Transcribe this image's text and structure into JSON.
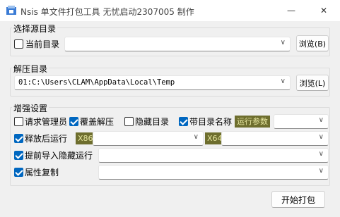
{
  "window": {
    "title": "Nsis 单文件打包工具 无忧启动2307005 制作",
    "minimize_glyph": "—",
    "close_glyph": "✕",
    "app_icon": "nsis-installer-icon"
  },
  "source_group": {
    "legend": "选择源目录",
    "current_dir_label": "当前目录",
    "current_dir_checked": false,
    "source_path": "",
    "browse_label": "浏览(B)"
  },
  "extract_group": {
    "legend": "解压目录",
    "extract_path": "01:C:\\Users\\CLAM\\AppData\\Local\\Temp",
    "browse_label": "浏览(L)"
  },
  "enhance_group": {
    "legend": "增强设置",
    "request_admin_label": "请求管理员",
    "request_admin_checked": false,
    "overwrite_label": "覆盖解压",
    "overwrite_checked": true,
    "hide_dir_label": "隐藏目录",
    "hide_dir_checked": false,
    "with_dir_name_label": "带目录名称",
    "with_dir_name_checked": true,
    "run_params_tag": "运行参数",
    "run_params_value": "",
    "run_after_label": "释放后运行",
    "run_after_checked": true,
    "x86_tag": "X86",
    "x86_value": "",
    "x64_tag": "X64",
    "x64_value": "",
    "pre_import_label": "提前导入隐藏运行",
    "pre_import_checked": true,
    "pre_import_value": "",
    "attr_copy_label": "属性复制",
    "attr_copy_checked": true,
    "attr_copy_value": ""
  },
  "pack_button_label": "开始打包",
  "colors": {
    "accent": "#0067c0",
    "tag_bg": "#6e6e2e",
    "tag_fg": "#e6e6a0"
  }
}
